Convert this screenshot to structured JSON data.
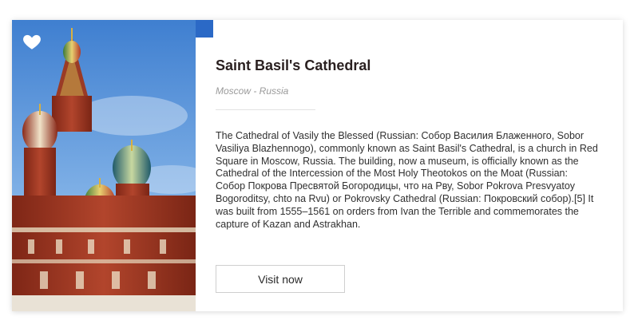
{
  "card": {
    "title": "Saint Basil's Cathedral",
    "location": "Moscow - Russia",
    "description": "The Cathedral of Vasily the Blessed (Russian: Собор Василия Блаженного, Sobor Vasiliya Blazhennogo), commonly known as Saint Basil's Cathedral, is a church in Red Square in Moscow, Russia. The building, now a museum, is officially known as the Cathedral of the Intercession of the Most Holy Theotokos on the Moat (Russian: Собор Покрова Пресвятой Богородицы, что на Рву, Sobor Pokrova Presvyatoy Bogoroditsy, chto na Rvu) or Pokrovsky Cathedral (Russian: Покровский собор).[5] It was built from 1555–1561 on orders from Ivan the Terrible and commemorates the capture of Kazan and Astrakhan.",
    "button_label": "Visit now",
    "favorite_icon": "heart-icon"
  },
  "colors": {
    "accent": "#2b69c6",
    "title": "#2a2020",
    "subtitle": "#9a9a9a",
    "sky": "#4f8fd8",
    "brick": "#a83a25"
  }
}
